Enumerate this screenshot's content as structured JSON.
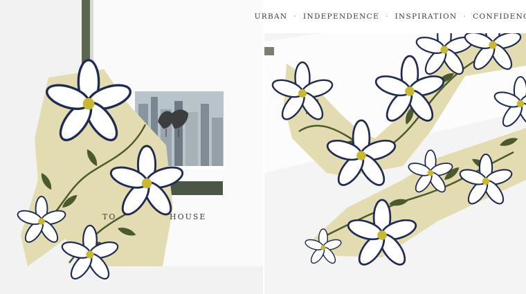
{
  "tagline": {
    "items": [
      "URBAN",
      "INDEPENDENCE",
      "INSPIRATION",
      "CONFIDENCE"
    ],
    "separator": "·"
  },
  "left_photo": {
    "book_text_left": "TO",
    "book_text_right": "HOUSE"
  },
  "colors": {
    "scarf_base": "#e2dcb0",
    "leaf": "#4b5a2c",
    "petal": "#ffffff",
    "petal_outline": "#1f2b52",
    "flower_center": "#c9b833",
    "background": "#f3f3f3"
  }
}
